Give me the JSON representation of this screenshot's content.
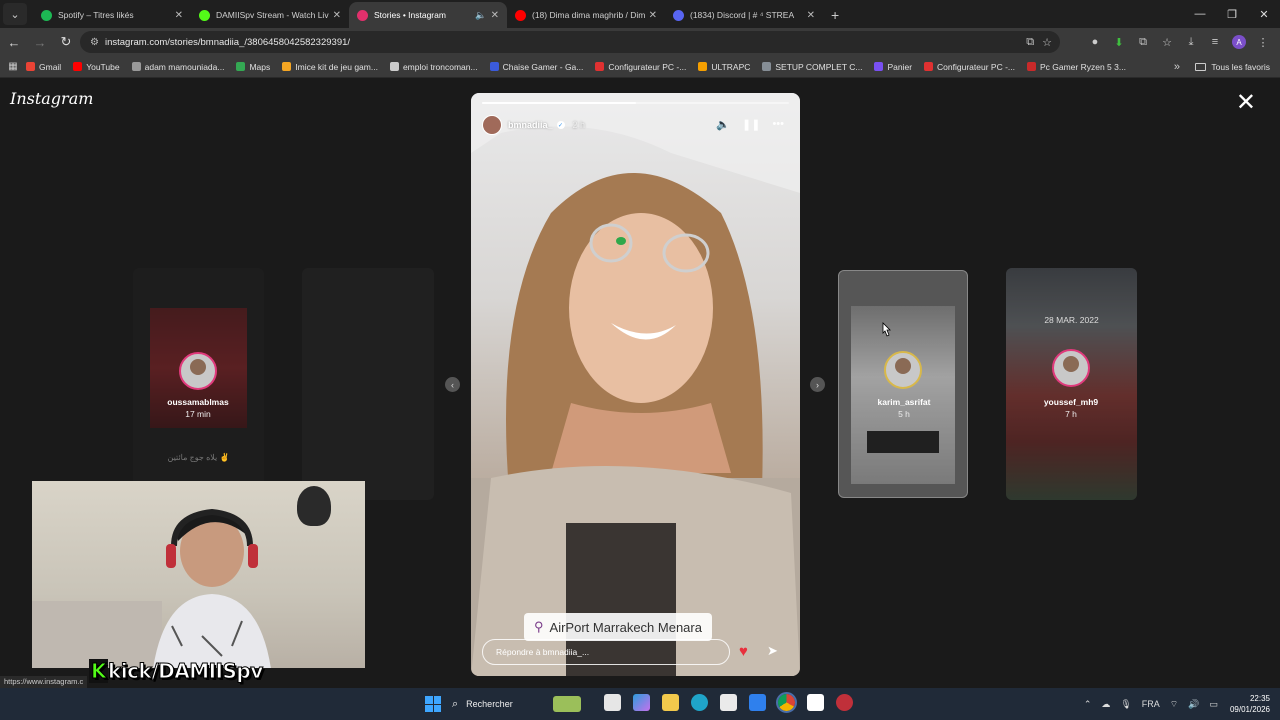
{
  "browser": {
    "tabs": [
      {
        "title": "Spotify – Titres likés",
        "color": "#1db954",
        "active": false
      },
      {
        "title": "DAMIISpv Stream - Watch Live",
        "color": "#53fc18",
        "active": false
      },
      {
        "title": "Stories • Instagram",
        "color": "#e1306c",
        "active": true
      },
      {
        "title": "(18) Dima dima maghrib / Dim",
        "color": "#ff0000",
        "active": false
      },
      {
        "title": "(1834) Discord | # ⁴ STREA",
        "color": "#5865f2",
        "active": false
      }
    ],
    "new_tab": "+",
    "url": "instagram.com/stories/bmnadiia_/3806458042582329391/",
    "bookmarks": [
      {
        "label": "Gmail",
        "color": "#ea4335"
      },
      {
        "label": "YouTube",
        "color": "#ff0000"
      },
      {
        "label": "adam mamouniada...",
        "color": "#999999"
      },
      {
        "label": "Maps",
        "color": "#34a853"
      },
      {
        "label": "Imice kit de jeu gam...",
        "color": "#f5a623"
      },
      {
        "label": "emploi troncoman...",
        "color": "#cccccc"
      },
      {
        "label": "Chaise Gamer - Ga...",
        "color": "#3b5bdb"
      },
      {
        "label": "Configurateur PC -...",
        "color": "#e03131"
      },
      {
        "label": "ULTRAPC",
        "color": "#f59f00"
      },
      {
        "label": "SETUP COMPLET C...",
        "color": "#868e96"
      },
      {
        "label": "Panier",
        "color": "#7950f2"
      },
      {
        "label": "Configurateur PC -...",
        "color": "#e03131"
      },
      {
        "label": "Pc Gamer Ryzen 5 3...",
        "color": "#c92a2a"
      }
    ],
    "bookmarks_more": "»",
    "all_bookmarks": "Tous les favoris",
    "profile_initial": "A"
  },
  "page": {
    "logo": "Instagram",
    "close": "✕",
    "prev_arrow": "‹",
    "next_arrow": "›",
    "side_stories": [
      {
        "user": "oussamablmas",
        "time": "17 min"
      },
      {
        "user": "karim_asrifat",
        "time": "5 h"
      },
      {
        "user": "youssef_mh9",
        "time": "7 h",
        "date": "28 MAR. 2022"
      }
    ],
    "left_card_caption": "يلاه جوج مائتين ✌",
    "story": {
      "user": "bmnadiia_",
      "time": "2 h",
      "progress": 0.5,
      "location": "AirPort Marrakech Menara",
      "reply_placeholder": "Répondre à bmnadiia_..."
    }
  },
  "overlay": {
    "kick_prefix": "K",
    "kick_text": "kick/DAMIISpv",
    "status_url": "https://www.instagram.c"
  },
  "taskbar": {
    "search": "Rechercher",
    "lang": "FRA",
    "time": "22:35",
    "date": "09/01/2026"
  }
}
